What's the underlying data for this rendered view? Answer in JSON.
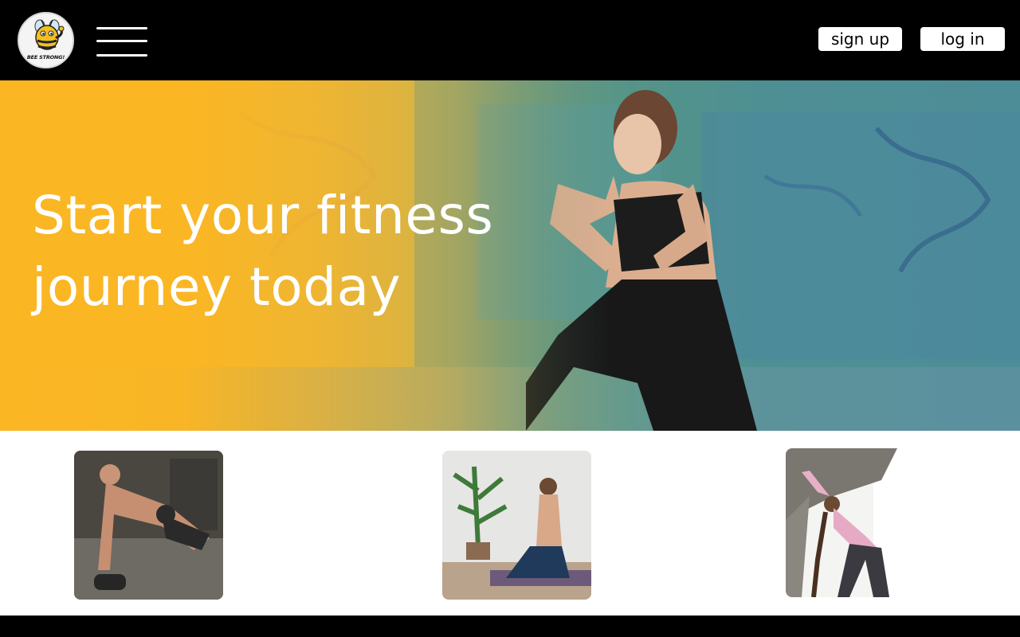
{
  "header": {
    "logo_text": "BEE STRONG!",
    "signup_label": "sign up",
    "login_label": "log in"
  },
  "hero": {
    "title_line1": "Start your fitness",
    "title_line2": "journey today"
  },
  "colors": {
    "brand_yellow": "#fbb623",
    "header_bg": "#000000",
    "button_bg": "#ffffff",
    "teal_wall": "#4d8a98"
  },
  "cards": [
    {
      "subject": "man doing dumbbell push-up"
    },
    {
      "subject": "woman meditating on yoga mat"
    },
    {
      "subject": "woman doing side stretch by window"
    }
  ]
}
